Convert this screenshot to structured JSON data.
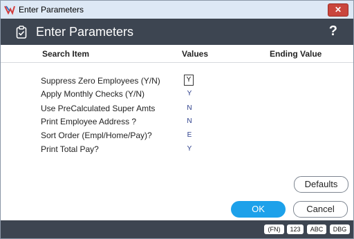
{
  "window": {
    "title": "Enter Parameters",
    "close_glyph": "✕"
  },
  "header": {
    "title": "Enter Parameters",
    "help": "?"
  },
  "columns": {
    "search_item": "Search Item",
    "values": "Values",
    "ending_value": "Ending Value"
  },
  "rows": [
    {
      "label": "Suppress Zero Employees (Y/N)",
      "value": "Y"
    },
    {
      "label": "Apply Monthly Checks (Y/N)",
      "value": "Y"
    },
    {
      "label": "Use PreCalculated Super Amts",
      "value": "N"
    },
    {
      "label": "Print Employee Address ?",
      "value": "N"
    },
    {
      "label": "Sort Order (Empl/Home/Pay)?",
      "value": "E"
    },
    {
      "label": "Print Total Pay?",
      "value": "Y"
    }
  ],
  "buttons": {
    "defaults": "Defaults",
    "ok": "OK",
    "cancel": "Cancel"
  },
  "footer_chips": [
    "(FN)",
    "123",
    "ABC",
    "DBG"
  ],
  "colors": {
    "header_bg": "#3d4551",
    "ok_button": "#1da1ea",
    "close_button": "#c9463d",
    "value_text": "#2a3c8a"
  }
}
